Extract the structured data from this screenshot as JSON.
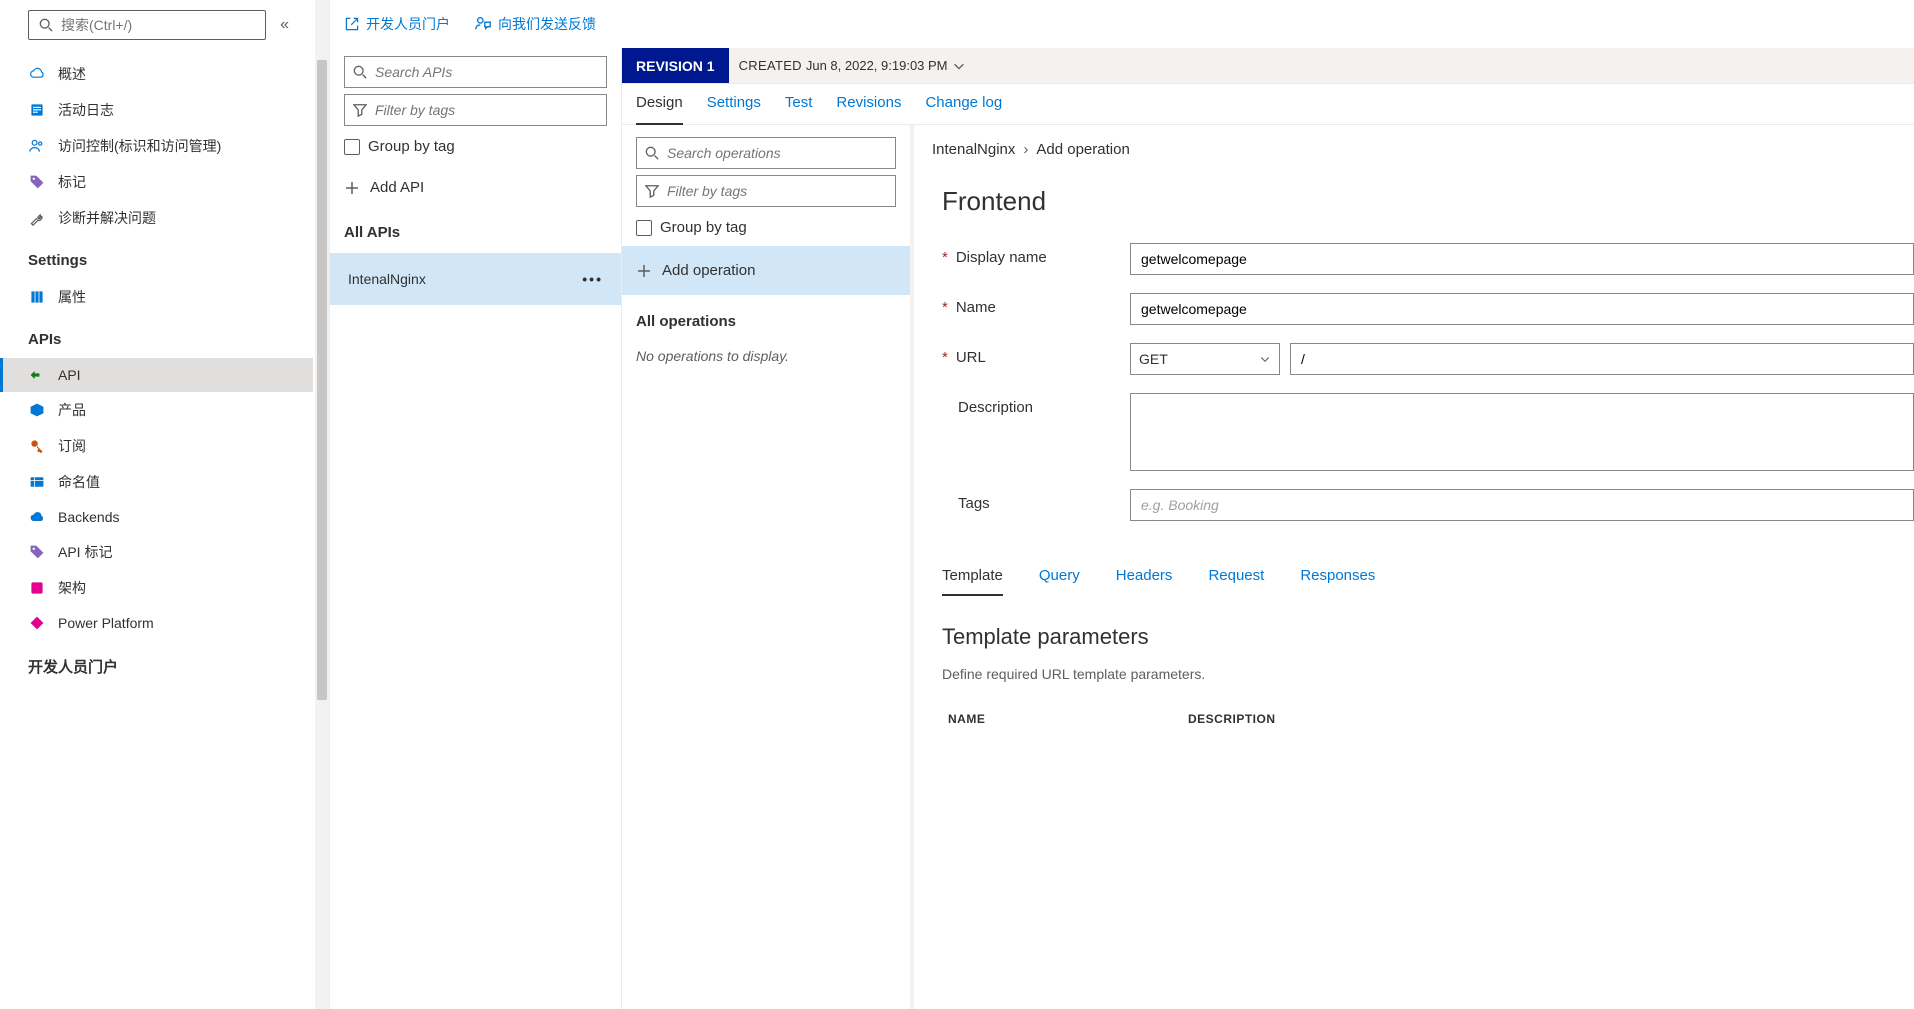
{
  "sidebar": {
    "search_placeholder": "搜索(Ctrl+/)",
    "items": [
      {
        "label": "概述"
      },
      {
        "label": "活动日志"
      },
      {
        "label": "访问控制(标识和访问管理)"
      },
      {
        "label": "标记"
      },
      {
        "label": "诊断并解决问题"
      }
    ],
    "settings_heading": "Settings",
    "settings_items": [
      {
        "label": "属性"
      }
    ],
    "apis_heading": "APIs",
    "apis_items": [
      {
        "label": "API"
      },
      {
        "label": "产品"
      },
      {
        "label": "订阅"
      },
      {
        "label": "命名值"
      },
      {
        "label": "Backends"
      },
      {
        "label": "API 标记"
      },
      {
        "label": "架构"
      },
      {
        "label": "Power Platform"
      }
    ],
    "devportal_heading": "开发人员门户"
  },
  "top_actions": {
    "developer_portal": "开发人员门户",
    "send_feedback": "向我们发送反馈"
  },
  "apis_panel": {
    "search_placeholder": "Search APIs",
    "filter_placeholder": "Filter by tags",
    "group_by_tag": "Group by tag",
    "add_api": "Add API",
    "all_apis": "All APIs",
    "selected_api": "IntenalNginx"
  },
  "revision": {
    "badge": "REVISION 1",
    "created_label": "CREATED",
    "created_value": "Jun 8, 2022, 9:19:03 PM"
  },
  "tabs": [
    "Design",
    "Settings",
    "Test",
    "Revisions",
    "Change log"
  ],
  "ops_panel": {
    "search_placeholder": "Search operations",
    "filter_placeholder": "Filter by tags",
    "group_by_tag": "Group by tag",
    "add_operation": "Add operation",
    "all_operations": "All operations",
    "empty": "No operations to display."
  },
  "breadcrumb": {
    "root": "IntenalNginx",
    "leaf": "Add operation"
  },
  "frontend": {
    "title": "Frontend",
    "labels": {
      "display_name": "Display name",
      "name": "Name",
      "url": "URL",
      "description": "Description",
      "tags": "Tags"
    },
    "values": {
      "display_name": "getwelcomepage",
      "name": "getwelcomepage",
      "method": "GET",
      "url_path": "/",
      "description": "",
      "tags_placeholder": "e.g. Booking"
    },
    "sub_tabs": [
      "Template",
      "Query",
      "Headers",
      "Request",
      "Responses"
    ],
    "template_params": {
      "title": "Template parameters",
      "help": "Define required URL template parameters.",
      "cols": [
        "NAME",
        "DESCRIPTION"
      ]
    }
  }
}
